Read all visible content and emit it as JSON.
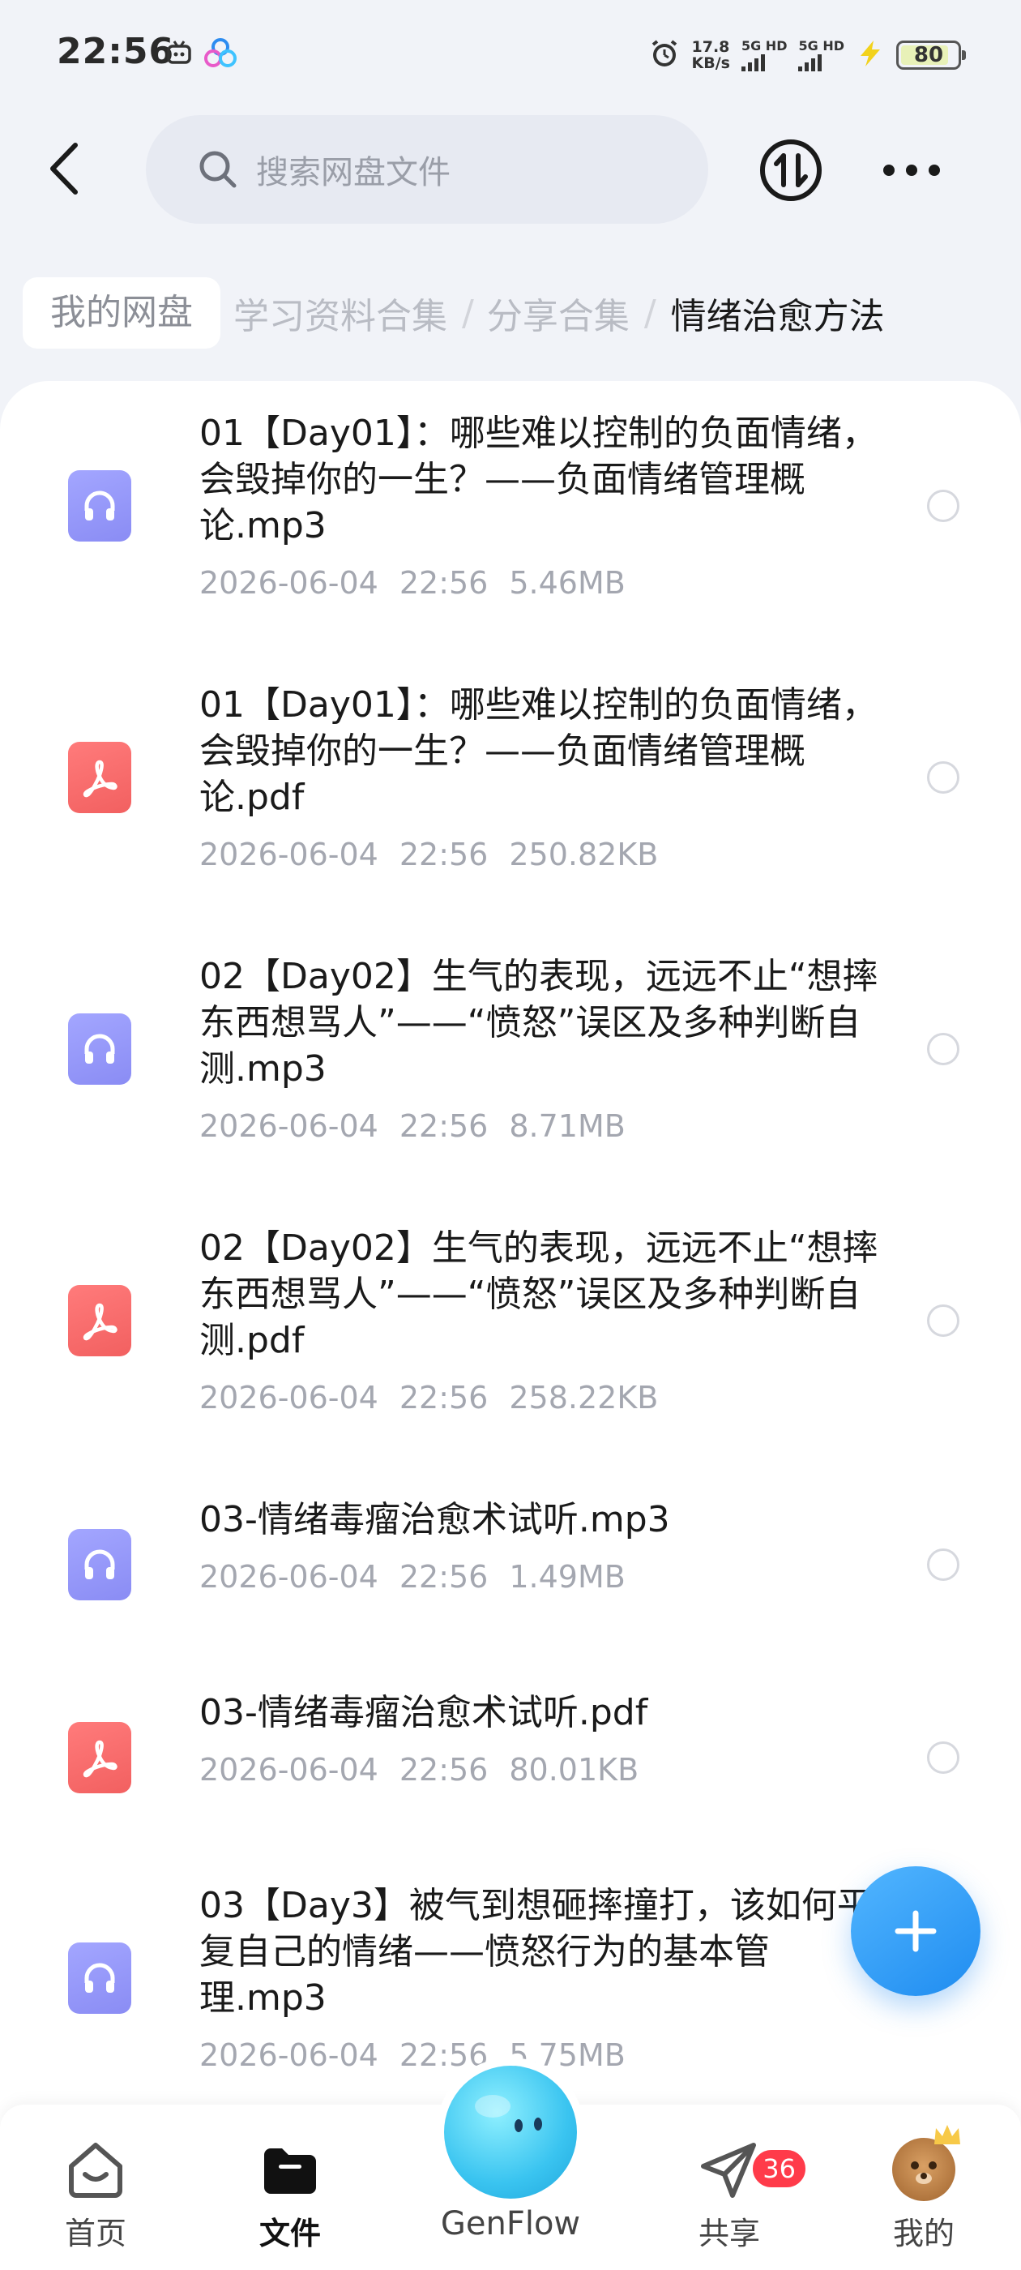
{
  "status_bar": {
    "time": "22:56",
    "speed_value": "17.8",
    "speed_unit": "KB/s",
    "sim1": "5G HD",
    "sim2": "5G HD",
    "battery": "80"
  },
  "header": {
    "back_icon": "chevron-left-icon",
    "search_placeholder": "搜索网盘文件",
    "transfer_icon": "transfer-icon",
    "more_icon": "more-dots-icon"
  },
  "breadcrumb": {
    "root": "我的网盘",
    "items": [
      "学习资料合集",
      "分享合集"
    ],
    "separator": "/",
    "current": "情绪治愈方法"
  },
  "files": [
    {
      "type": "audio",
      "name": "01【Day01】：哪些难以控制的负面情绪，会毁掉你的一生？——负面情绪管理概论.mp3",
      "date": "2026-06-04",
      "time": "22:56",
      "size": "5.46MB"
    },
    {
      "type": "pdf",
      "name": "01【Day01】：哪些难以控制的负面情绪，会毁掉你的一生？——负面情绪管理概论.pdf",
      "date": "2026-06-04",
      "time": "22:56",
      "size": "250.82KB"
    },
    {
      "type": "audio",
      "name": "02【Day02】生气的表现，远远不止“想摔东西想骂人”——“愤怒”误区及多种判断自测.mp3",
      "date": "2026-06-04",
      "time": "22:56",
      "size": "8.71MB"
    },
    {
      "type": "pdf",
      "name": "02【Day02】生气的表现，远远不止“想摔东西想骂人”——“愤怒”误区及多种判断自测.pdf",
      "date": "2026-06-04",
      "time": "22:56",
      "size": "258.22KB"
    },
    {
      "type": "audio",
      "name": "03-情绪毒瘤治愈术试听.mp3",
      "date": "2026-06-04",
      "time": "22:56",
      "size": "1.49MB"
    },
    {
      "type": "pdf",
      "name": "03-情绪毒瘤治愈术试听.pdf",
      "date": "2026-06-04",
      "time": "22:56",
      "size": "80.01KB"
    },
    {
      "type": "audio",
      "name": "03【Day3】被气到想砸摔撞打，该如何平复自己的情绪——愤怒行为的基本管理.mp3",
      "date": "2026-06-04",
      "time": "22:56",
      "size": "5.75MB"
    }
  ],
  "fab": {
    "icon": "plus-icon"
  },
  "bottom_nav": {
    "home": "首页",
    "files": "文件",
    "genflow": "GenFlow",
    "share": "共享",
    "share_badge": "36",
    "mine": "我的"
  },
  "colors": {
    "audio_icon": "#9597f8",
    "pdf_icon": "#f46a6a",
    "fab": "#2e9cf5",
    "badge": "#ff3b4a"
  }
}
